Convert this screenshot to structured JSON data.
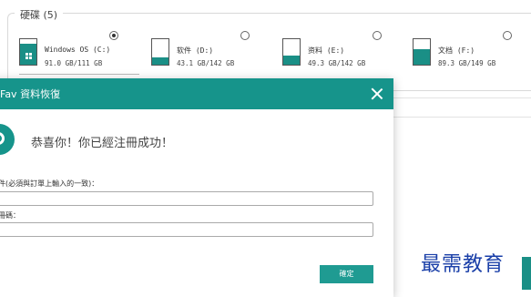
{
  "disk_panel": {
    "title": "硬碟 (5)",
    "drives": [
      {
        "name": "Windows OS (C:)",
        "size": "91.0 GB/111 GB",
        "fill": 0.82,
        "selected": true,
        "os": true
      },
      {
        "name": "软件 (D:)",
        "size": "43.1 GB/142 GB",
        "fill": 0.3,
        "selected": false,
        "os": false
      },
      {
        "name": "资料 (E:)",
        "size": "49.3 GB/142 GB",
        "fill": 0.35,
        "selected": false,
        "os": false
      },
      {
        "name": "文档 (F:)",
        "size": "89.3 GB/149 GB",
        "fill": 0.6,
        "selected": false,
        "os": false
      }
    ]
  },
  "dialog": {
    "title": "Fav 資料恢復",
    "success_message": "恭喜你！你已經注冊成功！",
    "email_label": "郵件(必須與訂單上輸入的一致)：",
    "email_value": "",
    "code_label": "註冊碼：",
    "code_value": "",
    "confirm_label": "確定"
  },
  "watermark": "最需教育",
  "colors": {
    "accent": "#16948b",
    "watermark": "#1a3fa8"
  }
}
